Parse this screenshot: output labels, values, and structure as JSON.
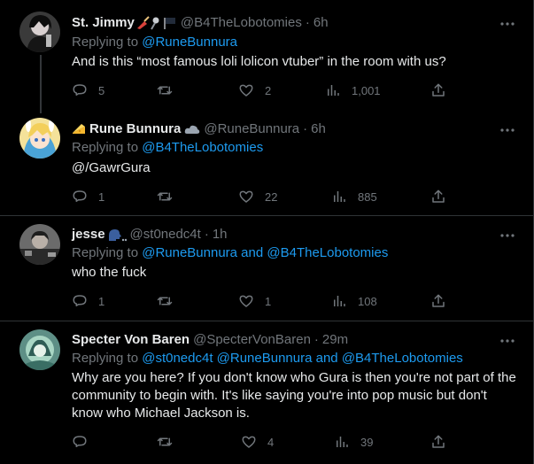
{
  "tweets": [
    {
      "display_name": "St. Jimmy",
      "name_emojis": "🎸🎤🏴",
      "handle": "@B4TheLobotomies",
      "time": "6h",
      "replying_prefix": "Replying to ",
      "replying_mentions": [
        "@RuneBunnura"
      ],
      "text": "And is this “most famous loli lolicon vtuber” in the room with us?",
      "replies": "5",
      "retweets": "",
      "likes": "2",
      "views": "1,001"
    },
    {
      "display_name": "Rune Bunnura",
      "name_emojis": "🧀☁",
      "handle": "@RuneBunnura",
      "time": "6h",
      "replying_prefix": "Replying to ",
      "replying_mentions": [
        "@B4TheLobotomies"
      ],
      "text": "@/GawrGura",
      "replies": "1",
      "retweets": "",
      "likes": "22",
      "views": "885"
    },
    {
      "display_name": "jesse",
      "name_emojis": "🗣.",
      "handle": "@st0nedc4t",
      "time": "1h",
      "replying_prefix": "Replying to ",
      "replying_mentions": [
        "@RuneBunnura and @B4TheLobotomies"
      ],
      "text": "who the fuck",
      "replies": "1",
      "retweets": "",
      "likes": "1",
      "views": "108"
    },
    {
      "display_name": "Specter Von Baren",
      "name_emojis": "",
      "handle": "@SpecterVonBaren",
      "time": "29m",
      "replying_prefix": "Replying to ",
      "replying_mentions": [
        "@st0nedc4t @RuneBunnura and @B4TheLobotomies"
      ],
      "text": "Why are you here? If you don't know who Gura is then you're not part of the community to begin with. It's like saying you're into pop music but don't know who Michael Jackson is.",
      "replies": "",
      "retweets": "",
      "likes": "4",
      "views": "39"
    }
  ],
  "separator": "·",
  "icons": {
    "reply": "reply-icon",
    "retweet": "retweet-icon",
    "like": "heart-icon",
    "views": "views-chart-icon",
    "share": "share-icon",
    "more": "more-dots-icon"
  },
  "colors": {
    "background": "#000000",
    "text": "#e7e9ea",
    "muted": "#71767b",
    "link": "#1d9bf0",
    "border": "#2f3336"
  }
}
